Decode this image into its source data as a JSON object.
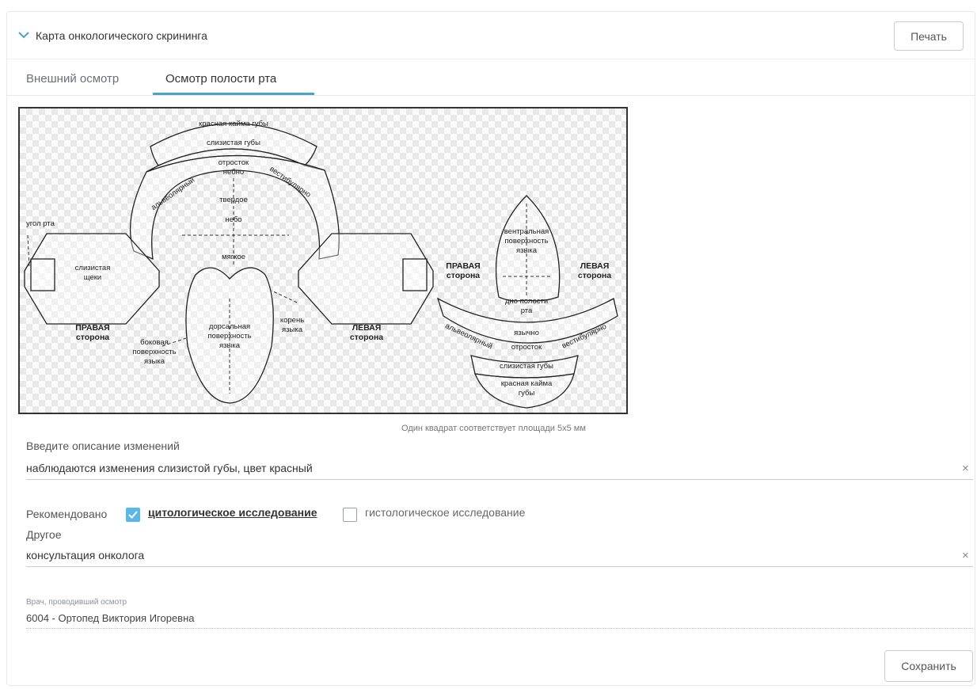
{
  "header": {
    "title": "Карта онкологического скрининга",
    "print_label": "Печать"
  },
  "tabs": [
    {
      "label": "Внешний осмотр",
      "active": false
    },
    {
      "label": "Осмотр полости рта",
      "active": true
    }
  ],
  "diagram": {
    "labels": {
      "lip_border": "красная кайма губы",
      "lip_mucosa": "слизистая губы",
      "alveolar": "альвеолярный",
      "process": "отросток",
      "palatal": "небно",
      "vestibular": "вестибулярно",
      "hard": "твердое",
      "palate": "небо",
      "soft": "мягкое",
      "mouth_corner": "угол рта",
      "cheek_1": "слизистая",
      "cheek_2": "щеки",
      "right_1": "ПРАВАЯ",
      "right_2": "сторона",
      "left_1": "ЛЕВАЯ",
      "left_2": "сторона",
      "lat_1": "боковая",
      "lat_2": "поверхность",
      "lat_3": "языка",
      "dors_1": "дорсальная",
      "dors_2": "поверхность",
      "dors_3": "языка",
      "root_1": "корень",
      "root_2": "языка",
      "ventral_1": "вентральная",
      "ventral_2": "поверхность",
      "ventral_3": "языка",
      "floor_1": "дно полости",
      "floor_2": "рта",
      "lingual": "язычно",
      "lower_lip_border_1": "красная кайма",
      "lower_lip_border_2": "губы"
    }
  },
  "scale_note": "Один квадрат соответствует площади 5x5 мм",
  "description": {
    "label": "Введите описание изменений",
    "value": "наблюдаются изменения слизистой губы, цвет красный"
  },
  "recommended": {
    "label": "Рекомендовано",
    "options": [
      {
        "label": "цитологическое исследование",
        "checked": true
      },
      {
        "label": "гистологическое исследование",
        "checked": false
      }
    ]
  },
  "other": {
    "label": "Другое",
    "value": "консультация онколога"
  },
  "doctor": {
    "label": "Врач, проводивший осмотр",
    "value": "6004 - Ортопед Виктория Игоревна"
  },
  "save_label": "Сохранить",
  "clear_symbol": "×",
  "colors": {
    "accent": "#4aa3c8",
    "checkbox": "#5ab7e6"
  }
}
